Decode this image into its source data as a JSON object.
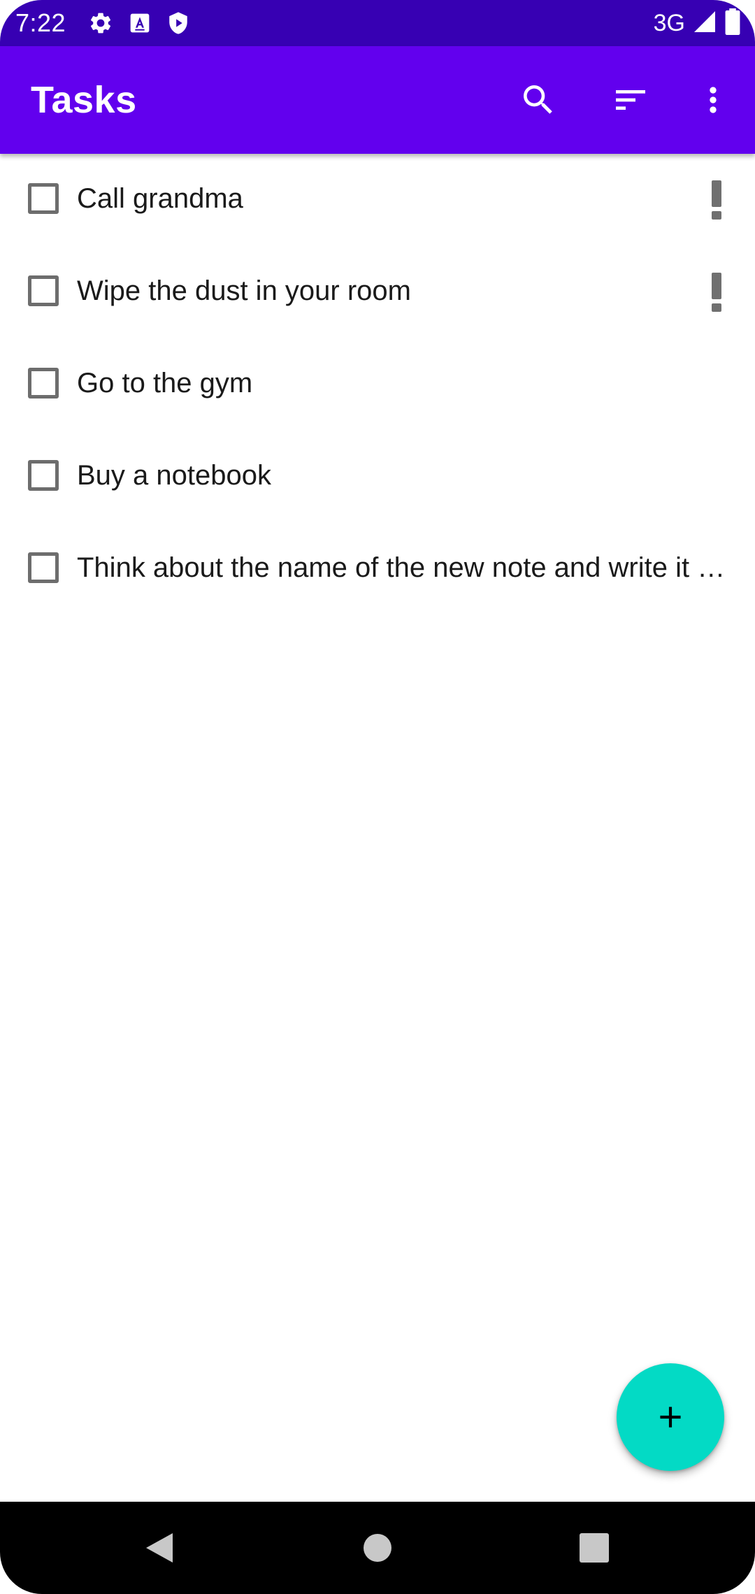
{
  "status_bar": {
    "time": "7:22",
    "network": "3G",
    "icons": [
      "settings-icon",
      "accessibility-keyboard-icon",
      "play-protect-icon",
      "signal-icon",
      "battery-icon"
    ]
  },
  "app_bar": {
    "title": "Tasks",
    "actions": [
      "search-icon",
      "sort-icon",
      "more-options-icon"
    ]
  },
  "tasks": [
    {
      "title": "Call grandma",
      "completed": false,
      "high_priority": true
    },
    {
      "title": "Wipe the dust in your room",
      "completed": false,
      "high_priority": true
    },
    {
      "title": "Go to the gym",
      "completed": false,
      "high_priority": false
    },
    {
      "title": "Buy a notebook",
      "completed": false,
      "high_priority": false
    },
    {
      "title": "Think about the name of the new note and write it down",
      "completed": false,
      "high_priority": false
    }
  ],
  "fab": {
    "icon": "add-icon"
  },
  "navigation": [
    "back-icon",
    "home-icon",
    "recents-icon"
  ],
  "colors": {
    "status_bar": "#3700b3",
    "app_bar": "#6200ee",
    "fab": "#03dac5",
    "priority": "#707070"
  }
}
